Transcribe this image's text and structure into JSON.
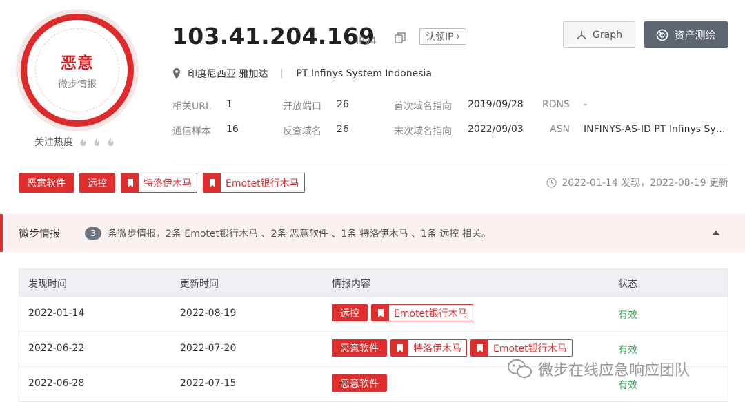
{
  "verdict": {
    "label": "恶意",
    "source": "微步情报"
  },
  "heat": {
    "label": "关注热度",
    "level": 0,
    "max": 3
  },
  "header": {
    "ip": "103.41.204.169",
    "ip_version": "IPv4",
    "claim_label": "认领IP",
    "location": "印度尼西亚 雅加达",
    "isp": "PT Infinys System Indonesia"
  },
  "actions": {
    "graph": "Graph",
    "assess": "资产测绘"
  },
  "meta": {
    "related_url_label": "相关URL",
    "related_url_value": "1",
    "open_ports_label": "开放端口",
    "open_ports_value": "26",
    "first_domain_label": "首次域名指向",
    "first_domain_value": "2019/09/28",
    "rdns_label": "RDNS",
    "rdns_value": "-",
    "comm_samples_label": "通信样本",
    "comm_samples_value": "16",
    "reverse_domain_label": "反查域名",
    "reverse_domain_value": "26",
    "last_domain_label": "末次域名指向",
    "last_domain_value": "2022/09/03",
    "asn_label": "ASN",
    "asn_value": "INFINYS-AS-ID PT Infinys Sy…"
  },
  "tags": [
    "恶意软件",
    "远控",
    "特洛伊木马",
    "Emotet银行木马"
  ],
  "dates_text": "2022-01-14 发现，2022-08-19 更新",
  "intel": {
    "title": "微步情报",
    "count": "3",
    "summary": "条微步情报，2条 Emotet银行木马 、2条 恶意软件 、1条 特洛伊木马 、1条 远控 相关。"
  },
  "table": {
    "headers": [
      "发现时间",
      "更新时间",
      "情报内容",
      "状态"
    ],
    "rows": [
      {
        "found": "2022-01-14",
        "updated": "2022-08-19",
        "tag_a": "远控",
        "tag_b": "Emotet银行木马",
        "status": "有效"
      },
      {
        "found": "2022-06-22",
        "updated": "2022-07-20",
        "tag_a": "恶意软件",
        "tag_b": "特洛伊木马",
        "tag_c": "Emotet银行木马",
        "status": "有效"
      },
      {
        "found": "2022-06-28",
        "updated": "2022-07-15",
        "tag_a": "恶意软件",
        "status": "有效"
      }
    ]
  },
  "watermark": "微步在线应急响应团队",
  "colors": {
    "danger": "#e02d2d",
    "valid": "#3aa757",
    "assess_button": "#5d6570"
  }
}
